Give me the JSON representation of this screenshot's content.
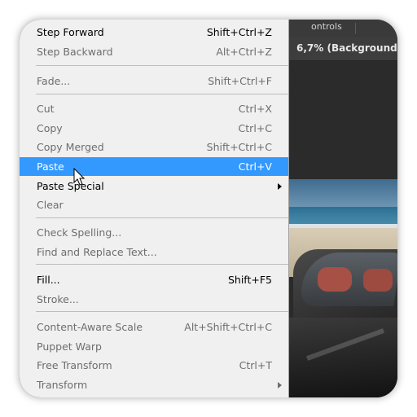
{
  "background_app": {
    "tab_fragment": "ontrols",
    "document_title_fragment": "6,7% (Background"
  },
  "menu": {
    "items": [
      {
        "label": "Step Forward",
        "shortcut": "Shift+Ctrl+Z",
        "enabled": true
      },
      {
        "label": "Step Backward",
        "shortcut": "Alt+Ctrl+Z",
        "enabled": false
      },
      {
        "label": "Fade...",
        "shortcut": "Shift+Ctrl+F",
        "enabled": false
      },
      {
        "label": "Cut",
        "shortcut": "Ctrl+X",
        "enabled": false
      },
      {
        "label": "Copy",
        "shortcut": "Ctrl+C",
        "enabled": false
      },
      {
        "label": "Copy Merged",
        "shortcut": "Shift+Ctrl+C",
        "enabled": false
      },
      {
        "label": "Paste",
        "shortcut": "Ctrl+V",
        "enabled": true,
        "highlighted": true
      },
      {
        "label": "Paste Special",
        "shortcut": "",
        "enabled": true,
        "submenu": true
      },
      {
        "label": "Clear",
        "shortcut": "",
        "enabled": false
      },
      {
        "label": "Check Spelling...",
        "shortcut": "",
        "enabled": false
      },
      {
        "label": "Find and Replace Text...",
        "shortcut": "",
        "enabled": false
      },
      {
        "label": "Fill...",
        "shortcut": "Shift+F5",
        "enabled": true
      },
      {
        "label": "Stroke...",
        "shortcut": "",
        "enabled": false
      },
      {
        "label": "Content-Aware Scale",
        "shortcut": "Alt+Shift+Ctrl+C",
        "enabled": false
      },
      {
        "label": "Puppet Warp",
        "shortcut": "",
        "enabled": false
      },
      {
        "label": "Free Transform",
        "shortcut": "Ctrl+T",
        "enabled": false
      },
      {
        "label": "Transform",
        "shortcut": "",
        "enabled": false,
        "submenu": true
      }
    ]
  },
  "colors": {
    "menu_bg": "#f0f0f0",
    "highlight": "#3399ff",
    "disabled_text": "#6d6d6d",
    "enabled_text": "#000000"
  },
  "cursor_icon": "arrow-pointer-icon"
}
